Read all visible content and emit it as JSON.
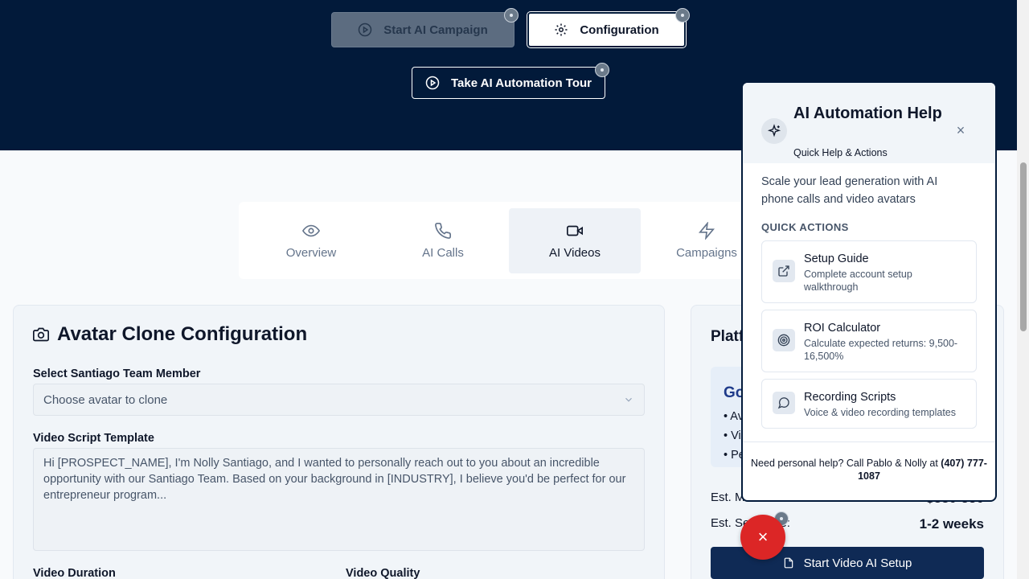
{
  "header": {
    "start_campaign": "Start AI Campaign",
    "configuration": "Configuration",
    "tour": "Take AI Automation Tour"
  },
  "tabs": [
    {
      "label": "Overview",
      "icon": "eye-icon"
    },
    {
      "label": "AI Calls",
      "icon": "phone-icon"
    },
    {
      "label": "AI Videos",
      "icon": "video-icon"
    },
    {
      "label": "Campaigns",
      "icon": "lightning-icon"
    }
  ],
  "avatar_card": {
    "title": "Avatar Clone Configuration",
    "member_label": "Select Santiago Team Member",
    "member_placeholder": "Choose avatar to clone",
    "script_label": "Video Script Template",
    "script_text": "Hi [PROSPECT_NAME], I'm Nolly Santiago, and I wanted to personally reach out to you about an incredible opportunity with our Santiago Team. Based on your background in [INDUSTRY], I believe you'd be perfect for our entrepreneur program...",
    "duration_label": "Video Duration",
    "quality_label": "Video Quality"
  },
  "platform_card": {
    "title_partial": "Platf",
    "box_title_partial": "Go",
    "bullets": [
      "• Av",
      "• Vi",
      "• Pe"
    ],
    "row1_label": "Est. M",
    "row1_value": "$330-550",
    "row2_label": "Est. Se",
    "row2_label_end": "e:",
    "row2_value": "1-2 weeks",
    "button": "Start Video AI Setup"
  },
  "help_panel": {
    "title": "AI Automation Help",
    "subtitle": "Quick Help & Actions",
    "description": "Scale your lead generation with AI phone calls and video avatars",
    "quick_actions_label": "QUICK ACTIONS",
    "actions": [
      {
        "title": "Setup Guide",
        "desc": "Complete account setup walkthrough"
      },
      {
        "title": "ROI Calculator",
        "desc": "Calculate expected returns: 9,500-16,500%"
      },
      {
        "title": "Recording Scripts",
        "desc": "Voice & video recording templates"
      }
    ],
    "footer_text": "Need personal help? Call Pablo & Nolly at ",
    "footer_phone": "(407) 777-1087"
  },
  "fab": {
    "label": "×"
  },
  "colors": {
    "header_bg": "#021a3a",
    "accent": "#0f2a55",
    "fab": "#dc2626"
  }
}
